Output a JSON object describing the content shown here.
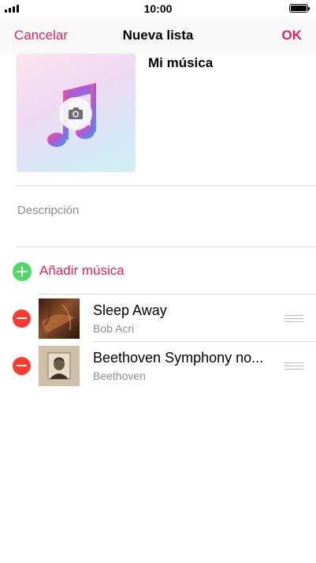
{
  "status_bar": {
    "time": "10:00"
  },
  "nav": {
    "cancel_label": "Cancelar",
    "title": "Nueva lista",
    "ok_label": "OK"
  },
  "playlist": {
    "name": "Mi música",
    "description_placeholder": "Descripción"
  },
  "add_music_label": "Añadir música",
  "songs": [
    {
      "title": "Sleep Away",
      "artist": "Bob Acri"
    },
    {
      "title": "Beethoven Symphony no...",
      "artist": "Beethoven"
    }
  ],
  "colors": {
    "accent": "#e0245e",
    "add": "#4cd964",
    "remove": "#ff3b30"
  },
  "icons": {
    "artwork": "music-note-icon",
    "camera": "camera-icon",
    "add": "plus-circle-icon",
    "remove": "minus-circle-icon",
    "reorder": "reorder-icon"
  }
}
